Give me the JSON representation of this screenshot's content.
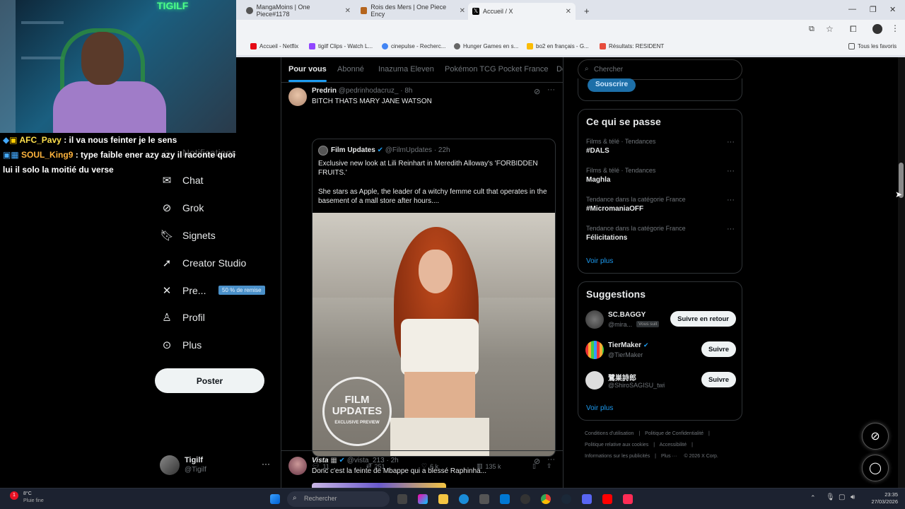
{
  "browser": {
    "tabs": [
      {
        "title": "MangaMoins | One Piece#1178"
      },
      {
        "title": "Rois des Mers | One Piece Ency"
      },
      {
        "title": "Accueil / X"
      }
    ],
    "new_tab": "+",
    "bookmarks": [
      {
        "label": "Accueil - Netflix"
      },
      {
        "label": "tigilf Clips - Watch L..."
      },
      {
        "label": "cinepulse - Recherc..."
      },
      {
        "label": "Hunger Games en s..."
      },
      {
        "label": "bo2 en français - G..."
      },
      {
        "label": "Résultats: RESIDENT"
      }
    ],
    "all_bookmarks": "Tous les favoris",
    "colors": {
      "chrome": "#dfe3eb",
      "toolbar": "#f1f3f6"
    }
  },
  "stream": {
    "cam_sign": "TIGILF",
    "chat": [
      {
        "user": "AFC_Pavy",
        "message": ": il va nous feinter je le sens"
      },
      {
        "user": "SOUL_King9",
        "message": ": type faible ener azy azy il raconte quoi lui il solo la moitié du verse"
      }
    ]
  },
  "nav": {
    "items": [
      {
        "label": "Notifications",
        "icon": "bell-icon"
      },
      {
        "label": "Chat",
        "icon": "mail-icon"
      },
      {
        "label": "Grok",
        "icon": "grok-icon"
      },
      {
        "label": "Signets",
        "icon": "bookmark-icon"
      },
      {
        "label": "Creator Studio",
        "icon": "rocket-icon"
      },
      {
        "label": "Pre...",
        "icon": "x-logo-icon"
      },
      {
        "label": "Profil",
        "icon": "person-icon"
      },
      {
        "label": "Plus",
        "icon": "more-circle-icon"
      }
    ],
    "premium_badge": "50 % de remise",
    "post_button": "Poster",
    "account": {
      "name": "Tigilf",
      "handle": "@Tigilf",
      "more": "···"
    }
  },
  "feed": {
    "tabs": [
      "Pour vous",
      "Abonné",
      "Inazuma Eleven",
      "Pokémon TCG Pocket France",
      "Dé"
    ],
    "tweet1": {
      "name": "Predrin",
      "handle": "@pedrinhodacruz_",
      "time": "· 8h",
      "text": "BITCH THATS MARY JANE WATSON",
      "quote": {
        "name": "Film Updates",
        "handle": "@FilmUpdates",
        "time": "· 22h",
        "text1": "Exclusive new look at Lili Reinhart in Meredith Alloway's 'FORBIDDEN FRUITS.'",
        "text2": "She stars as Apple, the leader of a witchy femme cult that operates in the basement of a mall store after hours....",
        "watermark_line1": "FILM",
        "watermark_line2": "UPDATES",
        "watermark_line3": "EXCLUSIVE PREVIEW"
      },
      "replies": "11",
      "retweets": "251",
      "likes": "6 k",
      "views": "135 k"
    },
    "tweet2": {
      "name": "Vista",
      "handle": "@vista_213",
      "time": "· 2h",
      "text": "Donc c'est la feinte de Mbappe qui a blessé Raphinha..."
    }
  },
  "sidebar": {
    "search_placeholder": "Chercher",
    "subscribe": "Souscrire",
    "trends_title": "Ce qui se passe",
    "trends": [
      {
        "category": "Films & télé · Tendances",
        "name": "#DALS"
      },
      {
        "category": "Films & télé · Tendances",
        "name": "Maghla"
      },
      {
        "category": "Tendance dans la catégorie France",
        "name": "#MicromaniaOFF"
      },
      {
        "category": "Tendance dans la catégorie France",
        "name": "Félicitations"
      }
    ],
    "show_more": "Voir plus",
    "suggestions_title": "Suggestions",
    "suggestions": [
      {
        "name": "SC.BAGGY",
        "handle": "@mira...",
        "badge": "Vous suit",
        "button": "Suivre en retour"
      },
      {
        "name": "TierMaker",
        "handle": "@TierMaker",
        "button": "Suivre"
      },
      {
        "name": "鷺巣詩郎",
        "handle": "@ShiroSAGISU_twi",
        "button": "Suivre"
      }
    ],
    "footer": [
      "Conditions d'utilisation",
      "|",
      "Politique de Confidentialité",
      "|",
      "Politique relative aux cookies",
      "|",
      "Accessibilité",
      "|",
      "Informations sur les publicités",
      "|",
      "Plus ···",
      "© 2026 X Corp."
    ]
  },
  "taskbar": {
    "weather_temp": "8°C",
    "weather_desc": "Pluie fine",
    "search_placeholder": "Rechercher",
    "time": "23:35",
    "date": "27/03/2026",
    "notif_count": "1"
  }
}
